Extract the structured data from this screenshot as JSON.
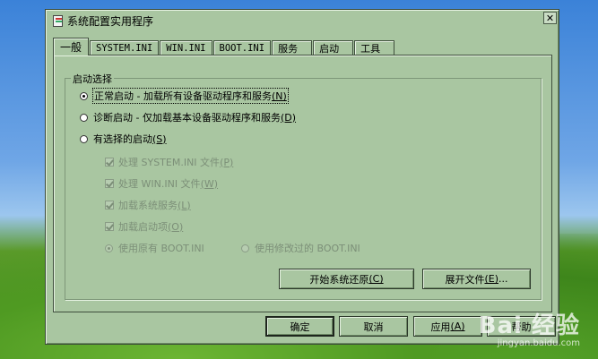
{
  "window": {
    "title": "系统配置实用程序",
    "close_glyph": "✕"
  },
  "tabs": [
    {
      "label": "一般",
      "active": true
    },
    {
      "label": "SYSTEM.INI"
    },
    {
      "label": "WIN.INI"
    },
    {
      "label": "BOOT.INI"
    },
    {
      "label": "服务"
    },
    {
      "label": "启动"
    },
    {
      "label": "工具"
    }
  ],
  "startup": {
    "group_title": "启动选择",
    "normal": {
      "text": "正常启动 - 加载所有设备驱动程序和服务",
      "accel": "(N)",
      "checked": true
    },
    "diagnostic": {
      "text": "诊断启动 - 仅加载基本设备驱动程序和服务",
      "accel": "(D)",
      "checked": false
    },
    "selective": {
      "text": "有选择的启动",
      "accel": "(S)",
      "checked": false
    },
    "options": [
      {
        "text": "处理 SYSTEM.INI 文件",
        "accel": "(P)",
        "checked": true
      },
      {
        "text": "处理 WIN.INI 文件",
        "accel": "(W)",
        "checked": true
      },
      {
        "text": "加载系统服务",
        "accel": "(L)",
        "checked": true
      },
      {
        "text": "加载启动项",
        "accel": "(O)",
        "checked": true
      }
    ],
    "boot_original": {
      "text": "使用原有 BOOT.INI",
      "checked": true
    },
    "boot_modified": {
      "text": "使用修改过的 BOOT.INI",
      "checked": false
    }
  },
  "panel_buttons": {
    "restore": {
      "text": "开始系统还原",
      "accel": "(C)"
    },
    "expand": {
      "text": "展开文件",
      "accel": "(E)",
      "suffix": "..."
    }
  },
  "footer_buttons": {
    "ok": "确定",
    "cancel": "取消",
    "apply": {
      "text": "应用",
      "accel": "(A)"
    },
    "help": "帮助"
  },
  "watermark": {
    "logo": "Bai 经验",
    "url": "jingyan.baidu.com"
  },
  "colors": {
    "dialog": "#a9c6a1",
    "desktop_sky": "#3b82d8",
    "desktop_grass": "#4f9a22"
  }
}
